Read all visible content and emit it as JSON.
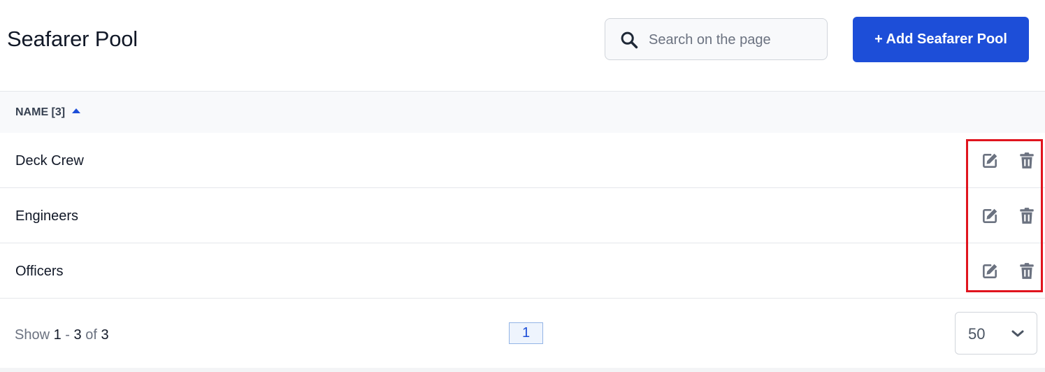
{
  "header": {
    "title": "Seafarer Pool",
    "search_placeholder": "Search on the page",
    "search_value": "",
    "add_button_label": "+ Add Seafarer Pool"
  },
  "table": {
    "columns": [
      {
        "label": "NAME [3]",
        "sort": "ascending"
      }
    ],
    "rows": [
      {
        "name": "Deck Crew",
        "actions": [
          "edit-icon",
          "trash-icon"
        ]
      },
      {
        "name": "Engineers",
        "actions": [
          "edit-icon",
          "trash-icon"
        ]
      },
      {
        "name": "Officers",
        "actions": [
          "edit-icon",
          "trash-icon"
        ]
      }
    ]
  },
  "footer": {
    "show_label": "Show",
    "range_start": "1",
    "range_sep": "-",
    "range_end": "3",
    "of_label": "of",
    "total": "3",
    "current_page": "1",
    "per_page": "50"
  },
  "colors": {
    "primary": "#1d4ed8",
    "highlight_border": "#e0141e",
    "icon_gray": "#6b7280"
  }
}
